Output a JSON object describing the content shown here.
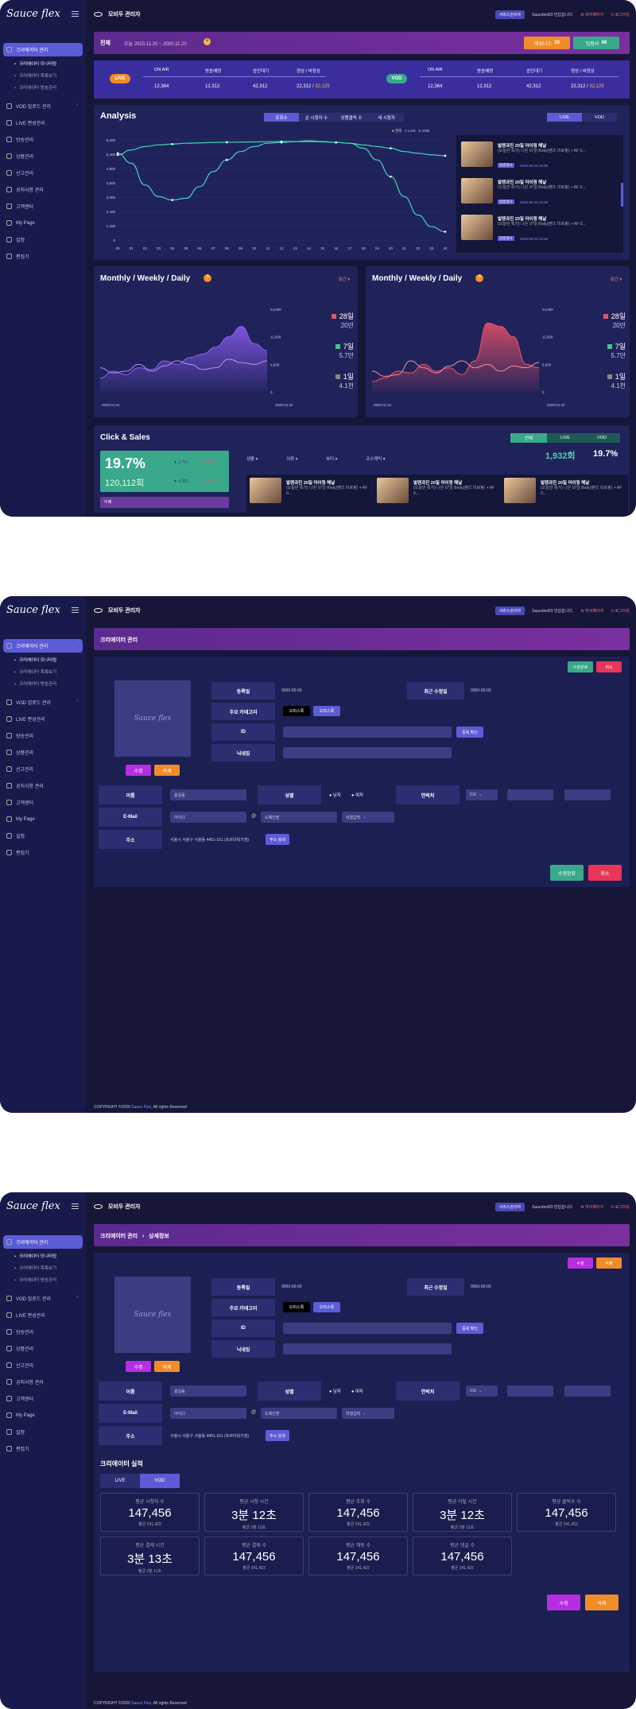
{
  "app": {
    "logo": "Sauce flex",
    "title": "모비두 관리자",
    "service_btn": "서비스관리자",
    "welcome": "Sauceled03 반갑습니다.",
    "mypage": "마이페이지",
    "logout": "로그아웃",
    "copyright_prefix": "COPYRIGHT ©2020 ",
    "copyright_brand": "Sauce Flex",
    "copyright_suffix": ", All rights Reserved"
  },
  "sidebar": {
    "active": "크리에이터 관리",
    "subs": [
      "크리에이터 모니터링",
      "크리에이터 목록보기",
      "크리에이터 방송관리"
    ],
    "items": [
      "VOD 업로드 관리",
      "LIVE 편성관리",
      "방송관리",
      "상품관리",
      "신고관리",
      "공지사항 관리",
      "고객센터",
      "My Page",
      "설정",
      "편집기"
    ]
  },
  "s1": {
    "banner": {
      "label": "전체",
      "period": "오늘 2020.11.20 ~ 2020.11.20",
      "btn1_label": "레위니스",
      "btn1_count": "58",
      "btn2_label": "입점사",
      "btn2_count": "86"
    },
    "live": {
      "badge": "LIVE",
      "cols": [
        "ON AIR",
        "방송예정",
        "승인대기",
        "정상 / 비정상"
      ],
      "vals": [
        "12,364",
        "12,312",
        "42,312",
        "22,312 / "
      ],
      "abnormal": "32,125"
    },
    "vod": {
      "badge": "VOD",
      "cols": [
        "ON AIR",
        "방송예정",
        "승인대기",
        "정상 / 비정상"
      ],
      "vals": [
        "12,364",
        "12,312",
        "42,312",
        "22,312 / "
      ],
      "abnormal": "32,125"
    },
    "analysis": {
      "title": "Analysis",
      "tabs": [
        "조회수",
        "순 시청자 수",
        "상품클릭 수",
        "새 시청자"
      ],
      "live_tab": "LIVE",
      "vod_tab": "VOD",
      "legend": [
        "결제",
        "LIVE",
        "VOD"
      ]
    },
    "videos": [
      {
        "title": "발렌과진 20일 마이핑 해날",
        "desc": "(오늘만 특가) 나은 07일 Body(팬즈 미로핑) + AF 0...",
        "badge": "방송일시",
        "date": "2020.09.03  13:05"
      },
      {
        "title": "발렌과진 20일 마이핑 해날",
        "desc": "(오늘만 특가) 나은 07일 Body(팬즈 미로핑) + AF 0...",
        "badge": "방송일시",
        "date": "2020.09.03  13:05"
      },
      {
        "title": "발렌과진 20일 마이핑 해날",
        "desc": "(오늘만 특가) 나은 07일 Body(팬즈 미로핑) + AF 0...",
        "badge": "방송일시",
        "date": "2020.09.03  13:05"
      }
    ],
    "mwd1": {
      "title": "Monthly / Weekly / Daily",
      "filter": "월간",
      "x_start": "2020.01.01",
      "x_end": "2020.01.31",
      "legend": [
        {
          "big": "28일",
          "small": "20만",
          "color": "#e8536a"
        },
        {
          "big": "7일",
          "small": "5.7만",
          "color": "#4fc08d"
        },
        {
          "big": "1일",
          "small": "4.1천",
          "color": "#888"
        }
      ]
    },
    "mwd2": {
      "title": "Monthly / Weekly / Daily",
      "filter": "월간",
      "x_start": "2020.01.01",
      "x_end": "2020.01.31",
      "legend": [
        {
          "big": "28일",
          "small": "20만",
          "color": "#e8536a"
        },
        {
          "big": "7일",
          "small": "5.7만",
          "color": "#4fc08d"
        },
        {
          "big": "1일",
          "small": "4.1천",
          "color": "#888"
        }
      ]
    },
    "click": {
      "title": "Click & Sales",
      "tabs": [
        "전체",
        "LIVE",
        "VOD"
      ],
      "count": "1,932회",
      "pct": "19.7%",
      "big_pct": "19.7%",
      "sub": "120,112회",
      "u1": "2.7%",
      "u2": "3.7%",
      "u3": "4,332",
      "u4": "4,332",
      "dropdowns": [
        "생활",
        "의류",
        "뷰티",
        "코스메틱"
      ],
      "stub": "이배"
    }
  },
  "creator_form": {
    "ranks": "크리에이터 관리",
    "detail_crumb": "상세정보",
    "edit_btn": "수정완료",
    "cancel_btn": "취소",
    "delete_btn": "삭제",
    "modify_btn": "수정",
    "reg_label": "등록일",
    "reg_val": "0000-00-00",
    "mod_label": "최근 수정일",
    "mod_val": "0000-00-00",
    "cat_label": "주요 카테고리",
    "cat1": "오피스룩",
    "cat2": "오피스룩",
    "id_label": "ID",
    "check_btn": "중복 확인",
    "nick_label": "닉네임",
    "name_label": "이름",
    "name_val": "홍길동",
    "gender_label": "성별",
    "male": "남자",
    "female": "여자",
    "phone_label": "연락처",
    "phone_sel": "010",
    "email_label": "E-Mail",
    "email_user": "아이디",
    "at": "@",
    "email_dom": "도메인명",
    "email_sel": "직접입력",
    "addr_label": "주소",
    "addr_val": "서울시 서울구 서울동 4451-151 (흐르타워가점)",
    "addr_btn": "주소 검색"
  },
  "perf": {
    "title": "크리에이터 실적",
    "tabs": [
      "LIVE",
      "VOD"
    ],
    "stats": [
      {
        "t": "평균 시청자 수",
        "v": "147,456",
        "s": "평균 241,422"
      },
      {
        "t": "평균 시청 시간",
        "v": "3분 12초",
        "s": "평균 2분 15초"
      },
      {
        "t": "평균 조회 수",
        "v": "147,456",
        "s": "평균 241,422"
      },
      {
        "t": "평균 이탈 시간",
        "v": "3분 12초",
        "s": "평균 2분 12초"
      },
      {
        "t": "평균 클릭수 수",
        "v": "147,456",
        "s": "평균 241,422"
      },
      {
        "t": "평균 결제 시간",
        "v": "3분 13초",
        "s": "평균 2분 11초"
      },
      {
        "t": "평균 결제 수",
        "v": "147,456",
        "s": "평균 241,422"
      },
      {
        "t": "평균 채팅 수",
        "v": "147,456",
        "s": "평균 241,422"
      },
      {
        "t": "평균 댓글 수",
        "v": "147,456",
        "s": "평균 241,422"
      }
    ]
  },
  "chart_data": [
    {
      "type": "line",
      "title": "Analysis",
      "x": [
        "00",
        "01",
        "02",
        "03",
        "04",
        "05",
        "06",
        "07",
        "08",
        "09",
        "10",
        "11",
        "12",
        "13",
        "14",
        "15",
        "16",
        "17",
        "18",
        "19",
        "20",
        "21",
        "22",
        "23",
        "24"
      ],
      "ylim": [
        0,
        6000
      ],
      "yticks": [
        "6,000",
        "5,400",
        "4,800",
        "3,600",
        "3,000",
        "2,400",
        "1,200",
        "0"
      ],
      "series": [
        {
          "values": [
            5200,
            4600,
            3300,
            2600,
            2400,
            2500,
            3200,
            4100,
            4800,
            5300,
            5600,
            5800,
            5850,
            5900,
            5950,
            5900,
            5850,
            5800,
            5700,
            5600,
            5500,
            5300,
            5200,
            5100,
            5050
          ]
        },
        {
          "values": [
            5100,
            5400,
            5600,
            5700,
            5750,
            5800,
            5820,
            5850,
            5860,
            5870,
            5880,
            5890,
            5900,
            5900,
            5900,
            5880,
            5850,
            5800,
            5500,
            4800,
            3800,
            2600,
            1500,
            800,
            500
          ]
        }
      ]
    },
    {
      "type": "area",
      "title": "Monthly / Weekly / Daily",
      "ylim": [
        0,
        24000
      ],
      "yticks": [
        "24,000",
        "11,000",
        "6,000",
        "0"
      ],
      "series": [
        {
          "values": [
            4000,
            6000,
            5000,
            7000,
            6500,
            9000,
            8000,
            10000,
            11000,
            13000,
            16000,
            19000,
            14000,
            12000
          ]
        },
        {
          "values": [
            7000,
            5500,
            6000,
            8000,
            6000,
            7500,
            9000,
            8000,
            6500,
            7000,
            9500,
            8500,
            8000,
            9000
          ]
        }
      ]
    },
    {
      "type": "area",
      "title": "Monthly / Weekly / Daily",
      "ylim": [
        0,
        24000
      ],
      "yticks": [
        "24,000",
        "11,000",
        "6,000",
        "0"
      ],
      "series": [
        {
          "values": [
            3000,
            4000,
            6000,
            5500,
            8000,
            6000,
            7000,
            5000,
            9000,
            20000,
            19000,
            16000,
            8000,
            7000
          ]
        },
        {
          "values": [
            6000,
            4500,
            5000,
            9000,
            7000,
            5500,
            7500,
            9000,
            7000,
            8000,
            6000,
            7500,
            7000,
            8500
          ]
        }
      ]
    }
  ]
}
